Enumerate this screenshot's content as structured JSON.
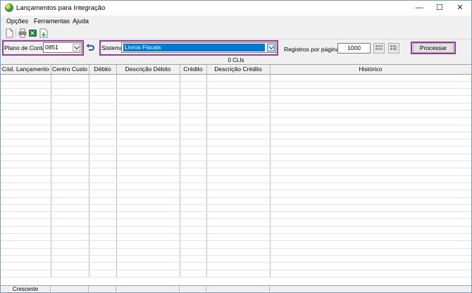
{
  "window": {
    "title": "Lançamentos para Integração",
    "controls": {
      "minimize": "—",
      "maximize": "☐",
      "close": "✕"
    }
  },
  "menu": [
    {
      "label": "Opções"
    },
    {
      "label": "Ferramentas"
    },
    {
      "label": "Ajuda"
    }
  ],
  "toolbar": {
    "icons": [
      "new-document-icon",
      "print-icon",
      "export-excel-icon",
      "import-icon"
    ]
  },
  "filters": {
    "plano_label": "Plano de Contas",
    "plano_value": "0851",
    "sistema_label": "Sistema",
    "sistema_value": "Livros Fiscais",
    "registros_label": "Registros por páginas:",
    "registros_value": "1000",
    "processar_label": "Processar"
  },
  "grid": {
    "count_text": "0 CLIs",
    "columns": [
      "Cód. Lançamento",
      "Centro Custo",
      "Débito",
      "Descrição Débito",
      "Crédito",
      "Descrição Crédito",
      "Histórico"
    ],
    "empty_rows": 28
  },
  "statusbar": {
    "sort_text": "Crescente"
  }
}
